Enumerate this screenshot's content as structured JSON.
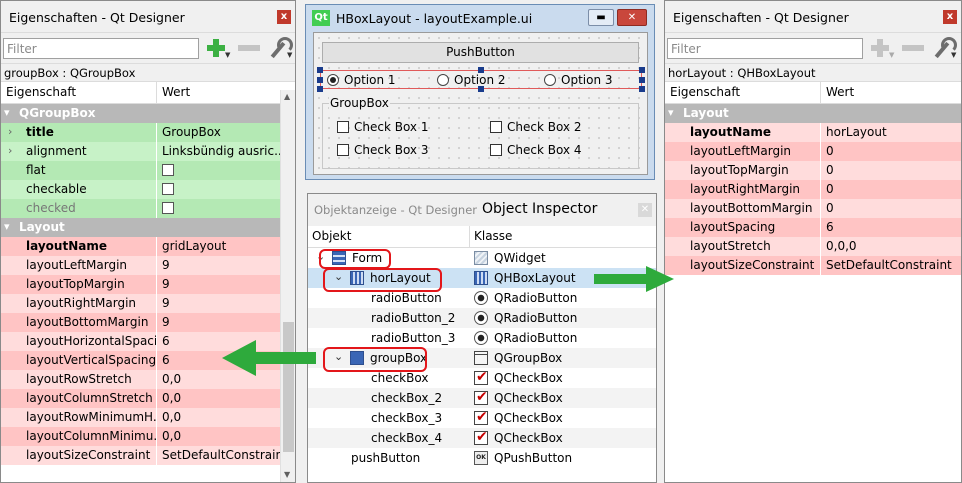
{
  "left_panel": {
    "title": "Eigenschaften - Qt Designer",
    "filter_placeholder": "Filter",
    "object_caption": "groupBox : QGroupBox",
    "header": {
      "property": "Eigenschaft",
      "value": "Wert"
    },
    "rows": [
      {
        "name": "QGroupBox",
        "value": "",
        "style": "group"
      },
      {
        "name": "title",
        "value": "GroupBox",
        "style": "g2",
        "bold": true,
        "chevron": true
      },
      {
        "name": "alignment",
        "value": "Linksbündig ausric...",
        "style": "g1",
        "chevron": true
      },
      {
        "name": "flat",
        "value": "",
        "style": "g2",
        "checkbox": true
      },
      {
        "name": "checkable",
        "value": "",
        "style": "g1",
        "checkbox": true
      },
      {
        "name": "checked",
        "value": "",
        "style": "g2",
        "checkbox": true,
        "grey": true
      },
      {
        "name": "Layout",
        "value": "",
        "style": "group"
      },
      {
        "name": "layoutName",
        "value": "gridLayout",
        "style": "r2",
        "bold": true
      },
      {
        "name": "layoutLeftMargin",
        "value": "9",
        "style": "r1"
      },
      {
        "name": "layoutTopMargin",
        "value": "9",
        "style": "r2"
      },
      {
        "name": "layoutRightMargin",
        "value": "9",
        "style": "r1"
      },
      {
        "name": "layoutBottomMargin",
        "value": "9",
        "style": "r2"
      },
      {
        "name": "layoutHorizontalSpacing",
        "value": "6",
        "style": "r1"
      },
      {
        "name": "layoutVerticalSpacing",
        "value": "6",
        "style": "r2"
      },
      {
        "name": "layoutRowStretch",
        "value": "0,0",
        "style": "r1"
      },
      {
        "name": "layoutColumnStretch",
        "value": "0,0",
        "style": "r2"
      },
      {
        "name": "layoutRowMinimumH...",
        "value": "0,0",
        "style": "r1"
      },
      {
        "name": "layoutColumnMinimu...",
        "value": "0,0",
        "style": "r2"
      },
      {
        "name": "layoutSizeConstraint",
        "value": "SetDefaultConstraint",
        "style": "r1"
      }
    ]
  },
  "designer_window": {
    "logo": "Qt",
    "title": "HBoxLayout - layoutExample.ui",
    "minimize": "▬",
    "maximize": "□",
    "close": "✕",
    "push_button": "PushButton",
    "radios": [
      {
        "label": "Option 1",
        "checked": true
      },
      {
        "label": "Option 2",
        "checked": false
      },
      {
        "label": "Option 3",
        "checked": false
      }
    ],
    "groupbox_title": "GroupBox",
    "checkboxes": [
      "Check Box 1",
      "Check Box 2",
      "Check Box 3",
      "Check Box 4"
    ]
  },
  "object_inspector": {
    "title_grey": "Objektanzeige - Qt Designer",
    "title": "Object Inspector",
    "close": "✕",
    "header": {
      "object": "Objekt",
      "class": "Klasse"
    },
    "rows": [
      {
        "name": "Form",
        "class": "QWidget",
        "icon": "widget",
        "indent": 0,
        "expand": true,
        "tree_icon": "form"
      },
      {
        "name": "horLayout",
        "class": "QHBoxLayout",
        "icon": "hbox",
        "indent": 1,
        "expand": true,
        "tree_icon": "hbox",
        "selected": true
      },
      {
        "name": "radioButton",
        "class": "QRadioButton",
        "icon": "radio",
        "indent": 2
      },
      {
        "name": "radioButton_2",
        "class": "QRadioButton",
        "icon": "radio",
        "indent": 2
      },
      {
        "name": "radioButton_3",
        "class": "QRadioButton",
        "icon": "radio",
        "indent": 2
      },
      {
        "name": "groupBox",
        "class": "QGroupBox",
        "icon": "group",
        "indent": 1,
        "expand": true,
        "tree_icon": "grid"
      },
      {
        "name": "checkBox",
        "class": "QCheckBox",
        "icon": "check",
        "indent": 2
      },
      {
        "name": "checkBox_2",
        "class": "QCheckBox",
        "icon": "check",
        "indent": 2
      },
      {
        "name": "checkBox_3",
        "class": "QCheckBox",
        "icon": "check",
        "indent": 2
      },
      {
        "name": "checkBox_4",
        "class": "QCheckBox",
        "icon": "check",
        "indent": 2
      },
      {
        "name": "pushButton",
        "class": "QPushButton",
        "icon": "push",
        "indent": 1.5
      }
    ],
    "push_icon_text": "OK"
  },
  "right_panel": {
    "title": "Eigenschaften - Qt Designer",
    "filter_placeholder": "Filter",
    "object_caption": "horLayout : QHBoxLayout",
    "header": {
      "property": "Eigenschaft",
      "value": "Wert"
    },
    "rows": [
      {
        "name": "Layout",
        "value": "",
        "style": "group"
      },
      {
        "name": "layoutName",
        "value": "horLayout",
        "style": "r1",
        "bold": true
      },
      {
        "name": "layoutLeftMargin",
        "value": "0",
        "style": "r2"
      },
      {
        "name": "layoutTopMargin",
        "value": "0",
        "style": "r1"
      },
      {
        "name": "layoutRightMargin",
        "value": "0",
        "style": "r2"
      },
      {
        "name": "layoutBottomMargin",
        "value": "0",
        "style": "r1"
      },
      {
        "name": "layoutSpacing",
        "value": "6",
        "style": "r2"
      },
      {
        "name": "layoutStretch",
        "value": "0,0,0",
        "style": "r1"
      },
      {
        "name": "layoutSizeConstraint",
        "value": "SetDefaultConstraint",
        "style": "r2"
      }
    ]
  },
  "close_label": "x",
  "arrow_color": "#2eaa3c",
  "highlight_color": "#e3161a"
}
